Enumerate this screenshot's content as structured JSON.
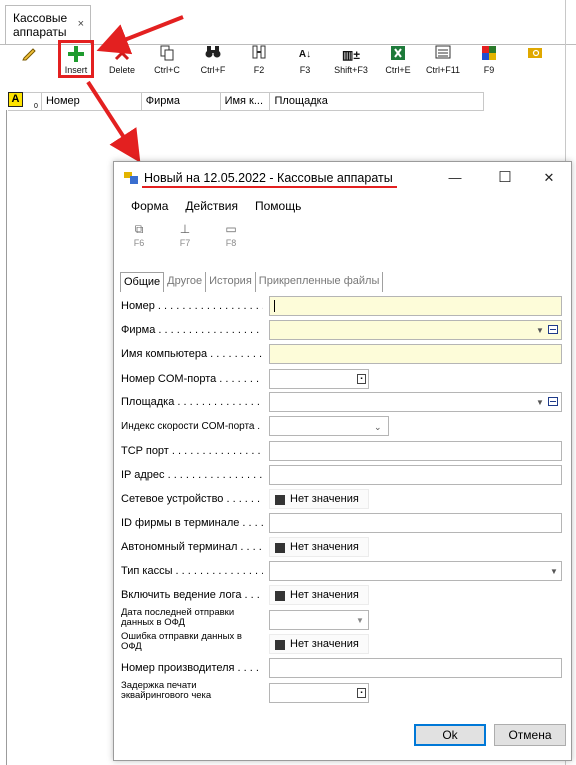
{
  "app": {
    "tab_title": "Кассовые аппараты",
    "tab_close": "×",
    "toolbar": [
      {
        "label": "",
        "icon": "pencil-icon"
      },
      {
        "label": "Insert",
        "icon": "plus-icon"
      },
      {
        "label": "Delete",
        "icon": "delete-icon"
      },
      {
        "label": "Ctrl+C",
        "icon": "copy-icon"
      },
      {
        "label": "Ctrl+F",
        "icon": "binoculars-icon"
      },
      {
        "label": "F2",
        "icon": "columns-icon"
      },
      {
        "label": "F3",
        "icon": "sort-icon"
      },
      {
        "label": "Shift+F3",
        "icon": "filter-icon"
      },
      {
        "label": "Ctrl+E",
        "icon": "excel-icon"
      },
      {
        "label": "Ctrl+F11",
        "icon": "list-icon"
      },
      {
        "label": "F9",
        "icon": "color-grid-icon"
      },
      {
        "label": "",
        "icon": "search-folder-icon"
      }
    ],
    "grid": {
      "flag": "A",
      "flag_sub": "0",
      "columns": [
        "Номер",
        "Фирма",
        "Имя к...",
        "Площадка"
      ]
    }
  },
  "dialog": {
    "title": "Новый на 12.05.2022 - Кассовые аппараты",
    "minimize": "—",
    "maximize": "☐",
    "close": "✕",
    "menu": [
      "Форма",
      "Действия",
      "Помощь"
    ],
    "tools": [
      {
        "label": "F6",
        "icon": "copy-doc-icon"
      },
      {
        "label": "F7",
        "icon": "hierarchy-icon"
      },
      {
        "label": "F8",
        "icon": "open-folder-icon"
      }
    ],
    "tabs": [
      "Общие",
      "Другое",
      "История",
      "Прикрепленные файлы"
    ],
    "fields": [
      {
        "label": "Номер"
      },
      {
        "label": "Фирма"
      },
      {
        "label": "Имя компьютера"
      },
      {
        "label": "Номер COM-порта"
      },
      {
        "label": "Площадка"
      },
      {
        "label": "Индекс скорости COM-порта"
      },
      {
        "label": "TCP порт"
      },
      {
        "label": "IP адрес"
      },
      {
        "label": "Сетевое устройство",
        "value": "Нет значения"
      },
      {
        "label": "ID фирмы в терминале"
      },
      {
        "label": "Автономный терминал",
        "value": "Нет значения"
      },
      {
        "label": "Тип кассы"
      },
      {
        "label": "Включить ведение лога",
        "value": "Нет значения"
      },
      {
        "label": "Дата последней отправки данных в ОФД"
      },
      {
        "label": "Ошибка отправки данных в ОФД",
        "value": "Нет значения"
      },
      {
        "label": "Номер производителя"
      },
      {
        "label": "Задержка печати эквайрингового чека"
      }
    ],
    "ok_label": "Ok",
    "cancel_label": "Отмена"
  },
  "colors": {
    "highlight": "#e32020",
    "required_field": "#fdfcd9",
    "accent": "#0078d7"
  }
}
